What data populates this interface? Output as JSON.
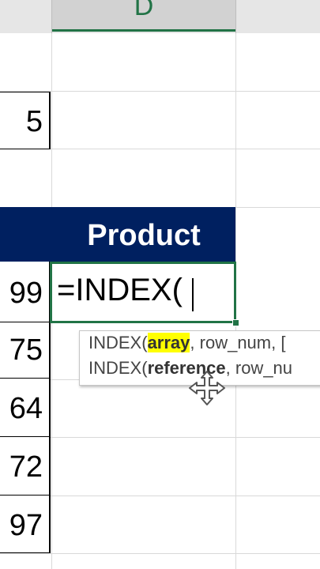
{
  "column_header": {
    "label": "D"
  },
  "cells": {
    "lookup_value": "5",
    "product_header": "Product",
    "values": [
      "99",
      "75",
      "64",
      "72",
      "97"
    ]
  },
  "formula": {
    "text": "=INDEX("
  },
  "tooltip": {
    "line1": {
      "prefix": "INDEX(",
      "arg": "array",
      "rest": ", row_num, ["
    },
    "line2": {
      "prefix": "INDEX(",
      "arg": "reference",
      "rest": ", row_nu"
    }
  },
  "colors": {
    "accent": "#217346",
    "header_fill": "#002060",
    "highlight": "#ffff00"
  },
  "icons": {
    "cursor": "move-cursor-icon"
  }
}
